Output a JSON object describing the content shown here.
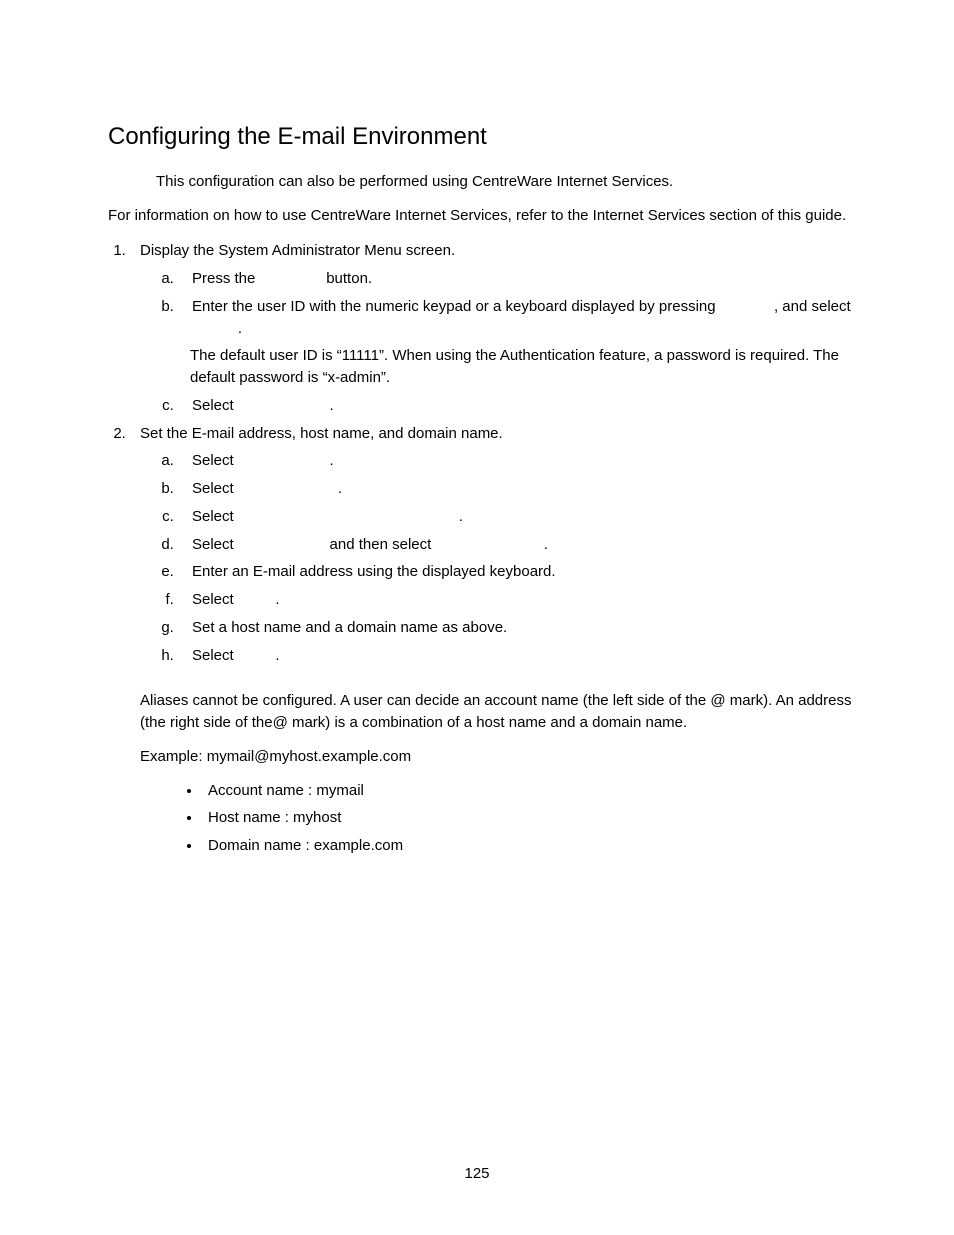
{
  "heading": "Configuring the E-mail Environment",
  "intro_note": "This configuration can also be performed using CentreWare Internet Services.",
  "intro_para": "For information on how to use CentreWare Internet Services, refer to the Internet Services section of this guide.",
  "steps": {
    "s1": {
      "text": "Display the System Administrator Menu screen.",
      "a": "Press the                 button.",
      "b": "Enter the user ID with the numeric keypad or a keyboard displayed by pressing              , and select            .",
      "b_note": "The default user ID is “11111”. When using the Authentication feature, a password is required. The default password is “x-admin”.",
      "c": "Select                       ."
    },
    "s2": {
      "text": "Set the E-mail address, host name, and domain name.",
      "a": "Select                       .",
      "b": "Select                         .",
      "c": "Select                                                      .",
      "d": "Select                       and then select                           .",
      "e": "Enter an E-mail address using the displayed keyboard.",
      "f": "Select          .",
      "g": "Set a host name and a domain name as above.",
      "h": "Select          ."
    }
  },
  "aliases_para": "Aliases cannot be configured. A user can decide an account name (the left side of the @ mark). An address (the right side of the@ mark) is a combination of a host name and a domain name.",
  "example_line": "Example: mymail@myhost.example.com",
  "bullets": {
    "b1": "Account name : mymail",
    "b2": "Host name : myhost",
    "b3": "Domain name : example.com"
  },
  "page_number": "125"
}
